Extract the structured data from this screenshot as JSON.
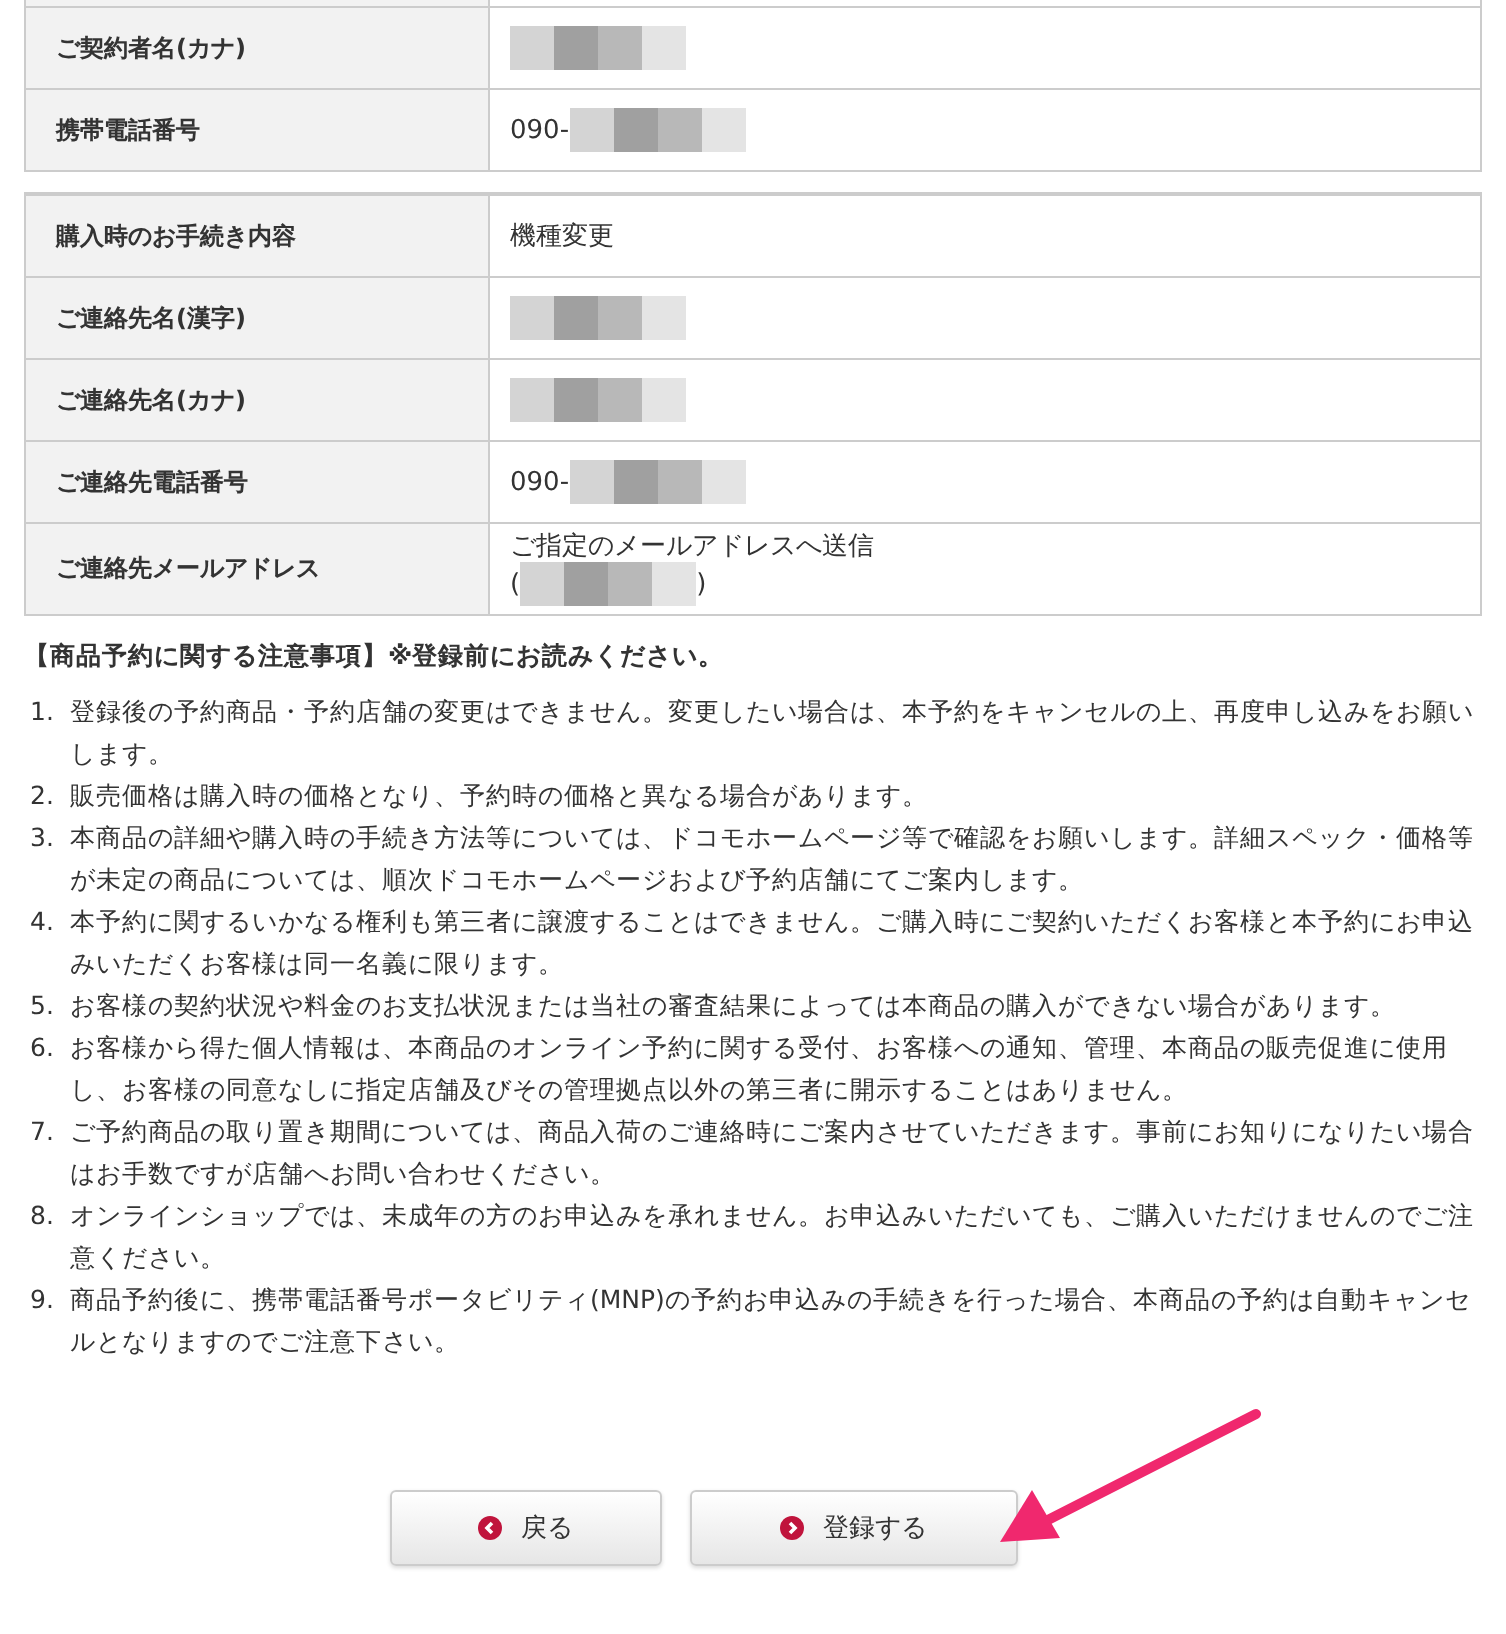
{
  "tables": [
    {
      "cut_top": true,
      "rows": [
        {
          "label": "ご契約者名(カナ)",
          "lines": [
            [
              {
                "kind": "blur"
              }
            ]
          ]
        },
        {
          "label": "携帯電話番号",
          "lines": [
            [
              {
                "kind": "text",
                "text": "090-"
              },
              {
                "kind": "blur"
              }
            ]
          ]
        }
      ]
    },
    {
      "cut_top": false,
      "rows": [
        {
          "label": "購入時のお手続き内容",
          "lines": [
            [
              {
                "kind": "text",
                "text": "機種変更"
              }
            ]
          ]
        },
        {
          "label": "ご連絡先名(漢字)",
          "lines": [
            [
              {
                "kind": "blur"
              }
            ]
          ]
        },
        {
          "label": "ご連絡先名(カナ)",
          "lines": [
            [
              {
                "kind": "blur"
              }
            ]
          ]
        },
        {
          "label": "ご連絡先電話番号",
          "lines": [
            [
              {
                "kind": "text",
                "text": "090-"
              },
              {
                "kind": "blur"
              }
            ]
          ]
        },
        {
          "label": "ご連絡先メールアドレス",
          "lines": [
            [
              {
                "kind": "text",
                "text": "ご指定のメールアドレスへ送信"
              }
            ],
            [
              {
                "kind": "text",
                "text": "("
              },
              {
                "kind": "blur"
              },
              {
                "kind": "text",
                "text": ")"
              }
            ]
          ]
        }
      ]
    }
  ],
  "notice": {
    "title": "【商品予約に関する注意事項】※登録前にお読みください。",
    "items": [
      {
        "number": "1.",
        "text": "登録後の予約商品・予約店舗の変更はできません。変更したい場合は、本予約をキャンセルの上、再度申し込みをお願いします。"
      },
      {
        "number": "2.",
        "text": "販売価格は購入時の価格となり、予約時の価格と異なる場合があります。"
      },
      {
        "number": "3.",
        "text": "本商品の詳細や購入時の手続き方法等については、ドコモホームページ等で確認をお願いします。詳細スペック・価格等が未定の商品については、順次ドコモホームページおよび予約店舗にてご案内します。"
      },
      {
        "number": "4.",
        "text": "本予約に関するいかなる権利も第三者に譲渡することはできません。ご購入時にご契約いただくお客様と本予約にお申込みいただくお客様は同一名義に限ります。"
      },
      {
        "number": "5.",
        "text": "お客様の契約状況や料金のお支払状況または当社の審査結果によっては本商品の購入ができない場合があります。"
      },
      {
        "number": "6.",
        "text": "お客様から得た個人情報は、本商品のオンライン予約に関する受付、お客様への通知、管理、本商品の販売促進に使用し、お客様の同意なしに指定店舗及びその管理拠点以外の第三者に開示することはありません。"
      },
      {
        "number": "7.",
        "text": "ご予約商品の取り置き期間については、商品入荷のご連絡時にご案内させていただきます。事前にお知りになりたい場合はお手数ですが店舗へお問い合わせください。"
      },
      {
        "number": "8.",
        "text": "オンラインショップでは、未成年の方のお申込みを承れません。お申込みいただいても、ご購入いただけませんのでご注意ください。"
      },
      {
        "number": "9.",
        "text": "商品予約後に、携帯電話番号ポータビリティ(MNP)の予約お申込みの手続きを行った場合、本商品の予約は自動キャンセルとなりますのでご注意下さい。"
      }
    ]
  },
  "buttons": [
    {
      "label": "戻る",
      "kind": "back"
    },
    {
      "label": "登録する",
      "kind": "next"
    }
  ]
}
